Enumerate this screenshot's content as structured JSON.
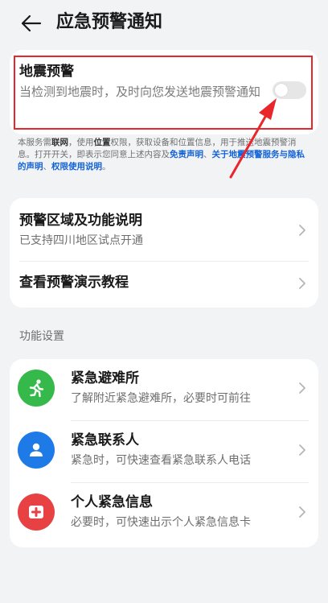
{
  "header": {
    "title": "应急预警通知"
  },
  "warning": {
    "title": "地震预警",
    "description": "当检测到地震时，及时向您发送地震预警通知",
    "toggle_on": false
  },
  "notice": {
    "part1": "本服务需",
    "bold1": "联网",
    "part2": "，使用",
    "bold2": "位置",
    "part3": "权限，获取设备和位置信息，用于推送地震预警消息。打开开关，即表示您同意上述内容及",
    "link1": "免责声明",
    "sep1": "、",
    "link2": "关于地震预警服务与隐私的声明",
    "sep2": "、",
    "link3": "权限使用说明",
    "end": "。"
  },
  "info": {
    "items": [
      {
        "title": "预警区域及功能说明",
        "subtitle": "已支持四川地区试点开通"
      },
      {
        "title": "查看预警演示教程"
      }
    ]
  },
  "functions": {
    "label": "功能设置",
    "items": [
      {
        "title": "紧急避难所",
        "subtitle": "了解附近紧急避难所，必要时可前往",
        "icon": "running-person-icon",
        "color": "#35b94b"
      },
      {
        "title": "紧急联系人",
        "subtitle": "紧急时，可快速查看紧急联系人电话",
        "icon": "contact-person-icon",
        "color": "#1d7ae6"
      },
      {
        "title": "个人紧急信息",
        "subtitle": "必要时，可快速出示个人紧急信息卡",
        "icon": "medical-cross-icon",
        "color": "#e84143"
      }
    ]
  },
  "colors": {
    "accent": "#1463d6",
    "highlight": "#e8262b",
    "background": "#f1f3f5"
  }
}
